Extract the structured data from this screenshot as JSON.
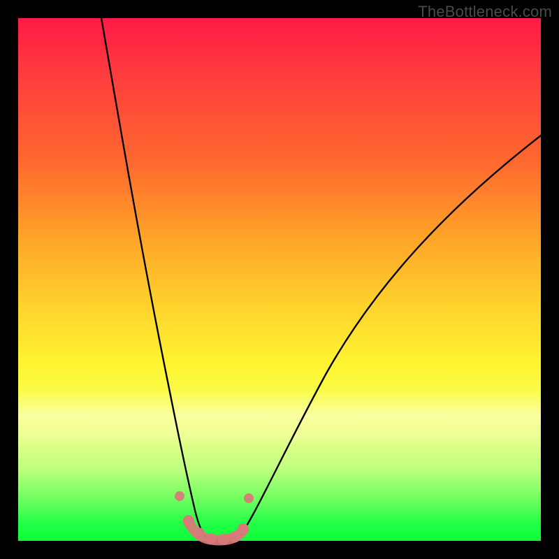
{
  "watermark": "TheBottleneck.com",
  "chart_data": {
    "type": "line",
    "title": "",
    "xlabel": "",
    "ylabel": "",
    "xlim": [
      0,
      100
    ],
    "ylim": [
      0,
      100
    ],
    "series": [
      {
        "name": "left-curve",
        "x": [
          16,
          18,
          20,
          22,
          24,
          26,
          28,
          30,
          31,
          32,
          33,
          34
        ],
        "values": [
          100,
          86,
          72,
          58,
          45,
          33,
          22,
          12,
          8,
          5,
          3,
          2
        ]
      },
      {
        "name": "right-curve",
        "x": [
          40,
          42,
          46,
          52,
          60,
          70,
          80,
          90,
          100
        ],
        "values": [
          2,
          4,
          10,
          20,
          33,
          48,
          60,
          70,
          78
        ]
      },
      {
        "name": "trough",
        "x": [
          34,
          35,
          36,
          37,
          38,
          39,
          40
        ],
        "values": [
          2,
          1,
          0.6,
          0.5,
          0.6,
          1,
          2
        ]
      }
    ],
    "markers": {
      "name": "marker-dots",
      "color": "#d97a7a",
      "points": [
        {
          "x": 30.5,
          "y": 9
        },
        {
          "x": 32.5,
          "y": 4
        },
        {
          "x": 34.5,
          "y": 1.8
        },
        {
          "x": 36.5,
          "y": 0.8
        },
        {
          "x": 38.5,
          "y": 1.6
        },
        {
          "x": 40.5,
          "y": 3.5
        },
        {
          "x": 42.0,
          "y": 8.5
        }
      ]
    },
    "gradient_stops": [
      {
        "pos": 0,
        "color": "#ff1a46"
      },
      {
        "pos": 28,
        "color": "#ff6a2e"
      },
      {
        "pos": 55,
        "color": "#ffd22c"
      },
      {
        "pos": 74,
        "color": "#f8ff50"
      },
      {
        "pos": 92,
        "color": "#70ff60"
      },
      {
        "pos": 100,
        "color": "#0cff36"
      }
    ]
  }
}
